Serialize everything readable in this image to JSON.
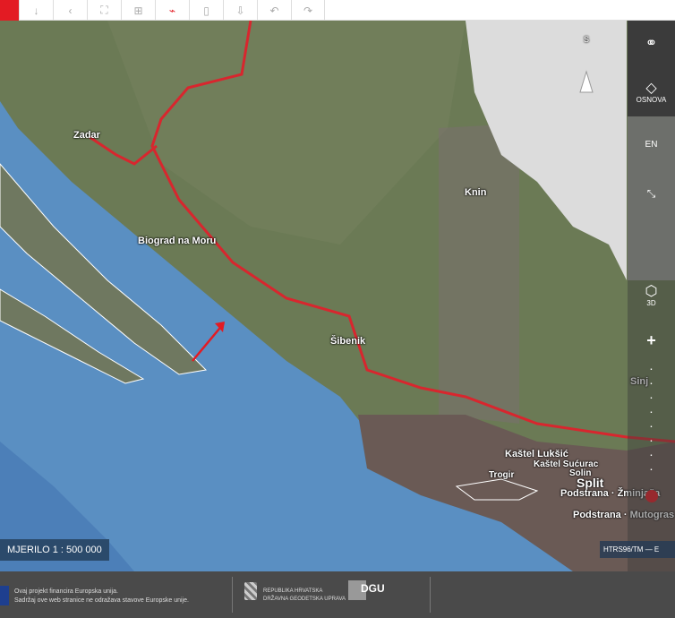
{
  "toolbar": {
    "buttons": [
      {
        "name": "download",
        "icon": "↓"
      },
      {
        "name": "back",
        "icon": "‹"
      },
      {
        "name": "fullscreen",
        "icon": "⛶"
      },
      {
        "name": "add-layer",
        "icon": "⊞"
      },
      {
        "name": "measure",
        "icon": "⌁",
        "active": true
      },
      {
        "name": "print",
        "icon": "▯"
      },
      {
        "name": "export",
        "icon": "⇩"
      },
      {
        "name": "undo",
        "icon": "↶"
      },
      {
        "name": "redo",
        "icon": "↷"
      }
    ]
  },
  "map": {
    "labels": {
      "zadar": "Zadar",
      "biograd": "Biograd na Moru",
      "knin": "Knin",
      "sibenik": "Šibenik",
      "sinj": "Sinj",
      "kastel_luksic": "Kaštel Lukšić",
      "kastel_sucurac": "Kaštel Sućurac",
      "solin": "Solin",
      "trogir": "Trogir",
      "split": "Split",
      "podstrana_zminjaca": "Podstrana · Žminjača",
      "podstrana_mutogras": "Podstrana · Mutogras"
    },
    "north_label": "S"
  },
  "sidebar": {
    "osnova": "OSNOVA",
    "en": "EN",
    "three_d": "3D",
    "zoom_in": "+",
    "zoom_out": "—"
  },
  "scale": "MJERILO 1 : 500 000",
  "scale_visible": "RILO 1 : 500 000",
  "crs": "HTRS96/TM",
  "crs_extra": "E",
  "footer": {
    "eu_line1": "Ovaj projekt financira Europska unija.",
    "eu_line2": "Sadržaj ove web stranice ne odražava stavove Europske unije.",
    "rh_line1": "REPUBLIKA HRVATSKA",
    "rh_line2": "DRŽAVNA GEODETSKA UPRAVA",
    "dgu": "DGU"
  },
  "colors": {
    "accent": "#e31b23",
    "sea": "#5a8fc2",
    "land": "#6b7a55"
  }
}
